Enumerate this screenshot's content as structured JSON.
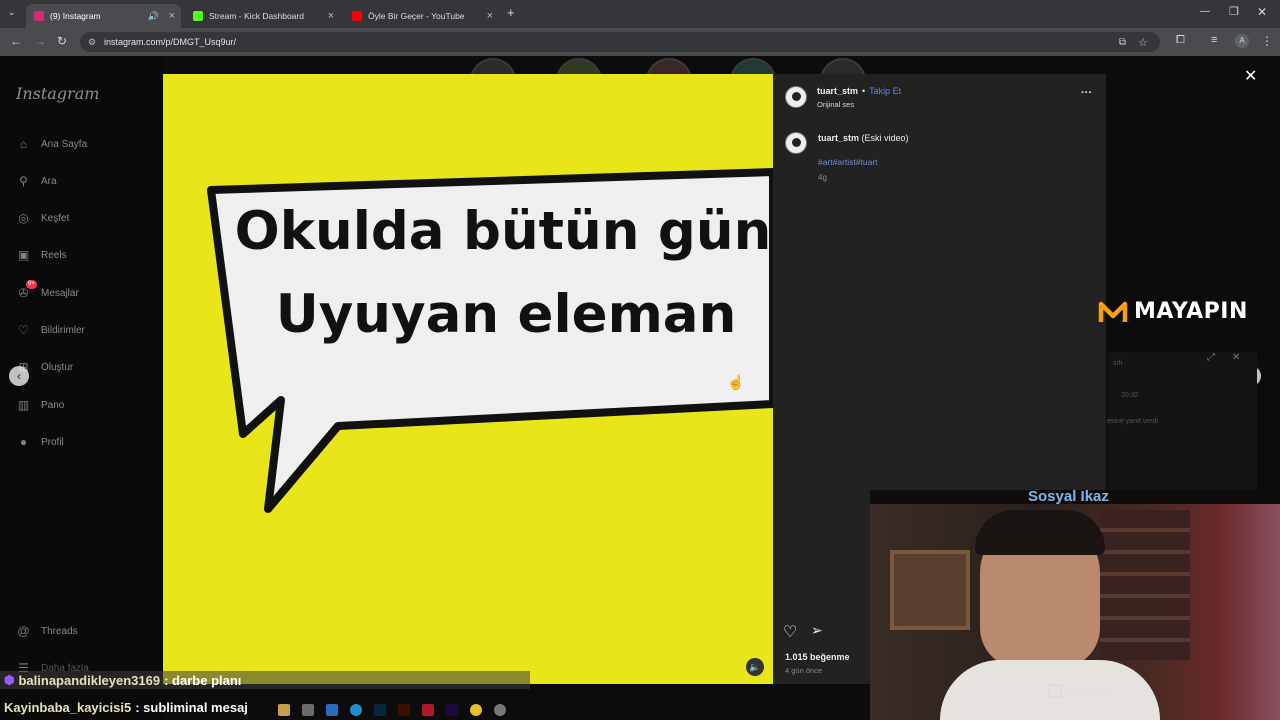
{
  "browser": {
    "tabs": [
      {
        "label": "(9) Instagram",
        "favicon_color": "#d62976",
        "active": true
      },
      {
        "label": "Stream - Kick Dashboard",
        "favicon_color": "#53fc18",
        "active": false
      },
      {
        "label": "Öyle Bir Geçer - YouTube",
        "favicon_color": "#ff0000",
        "active": false
      }
    ],
    "new_tab": "+",
    "url": "instagram.com/p/DMGT_Usq9ur/",
    "profile_initial": "A"
  },
  "instagram": {
    "logo": "Instagram",
    "nav": [
      "Ana Sayfa",
      "Ara",
      "Keşfet",
      "Reels",
      "Mesajlar",
      "Bildirimler",
      "Oluştur",
      "Pano",
      "Profil",
      "Threads",
      "Daha fazla"
    ],
    "nav_badge": "9+",
    "post": {
      "bubble_line1": "Okulda bütün gün",
      "bubble_line2": "Uyuyan eleman",
      "username": "tuart_stm",
      "separator": "•",
      "follow": "Takip Et",
      "audio": "Orijinal ses",
      "more": "···",
      "caption_user": "tuart_stm",
      "caption_text": "(Eski video)",
      "hashtags": "#art#artist#tuart",
      "caption_age": "4g",
      "likes": "1.015 beğenme",
      "post_age": "4 gün önce"
    }
  },
  "overlay": {
    "brand": "MAYAPIN",
    "cam_title": "Sosyal Ikaz",
    "cam_watermark": "XSplit VCam",
    "faded_texts": [
      "sıfı",
      "20:32",
      "esine yanıt verdi"
    ],
    "chat": [
      {
        "user": "balinapandikleyen3169",
        "text": ": darbe planı"
      },
      {
        "user": "Kayinbaba_kayicisi5",
        "text": ": subliminal mesaj"
      }
    ]
  },
  "colors": {
    "media_bg": "#e8e619",
    "follow": "#4c8cf7",
    "brand_orange": "#f5a00f"
  }
}
